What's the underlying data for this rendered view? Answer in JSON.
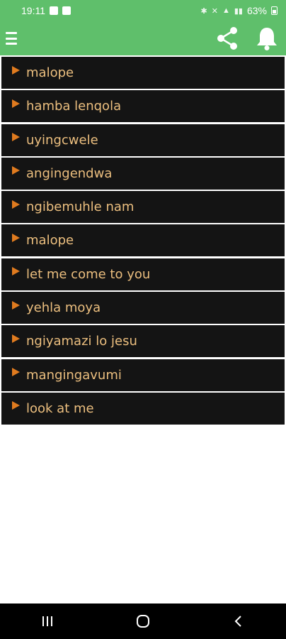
{
  "status_bar": {
    "time": "19:11",
    "battery": "63%"
  },
  "app_bar": {
    "menu_icon": "hamburger-menu-icon",
    "share_icon": "share-icon",
    "bell_icon": "notification-bell-icon",
    "background_color": "#5fbf6b"
  },
  "songs": [
    {
      "title": "malope"
    },
    {
      "title": "hamba lenqola"
    },
    {
      "title": "uyingcwele"
    },
    {
      "title": "angingendwa"
    },
    {
      "title": "ngibemuhle nam"
    },
    {
      "title": "malope"
    },
    {
      "title": "let me come to you"
    },
    {
      "title": "yehla moya"
    },
    {
      "title": "ngiyamazi lo jesu"
    },
    {
      "title": "mangingavumi"
    },
    {
      "title": "look at me"
    }
  ],
  "colors": {
    "list_item_bg": "#141414",
    "list_text": "#ecbf7f",
    "play_icon": "#e07b1f"
  },
  "nav_bar": {
    "recent_icon": "recent-apps-icon",
    "home_icon": "home-icon",
    "back_icon": "back-icon"
  }
}
